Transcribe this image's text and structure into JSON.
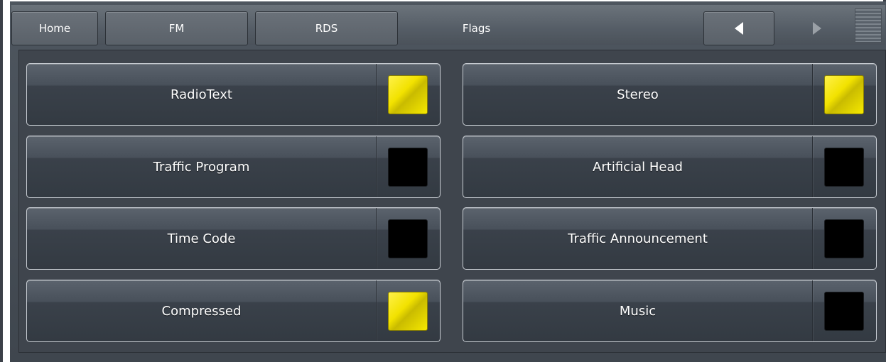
{
  "nav": {
    "home_label": "Home",
    "fm_label": "FM",
    "rds_label": "RDS",
    "page_label": "Flags",
    "prev_icon": "chevron-left-icon",
    "next_icon": "chevron-right-icon",
    "menu_icon": "menu-lines-icon"
  },
  "colors": {
    "lamp_on": "#f2e200",
    "lamp_off": "#000000"
  },
  "flags": [
    {
      "label": "RadioText",
      "state": "on"
    },
    {
      "label": "Stereo",
      "state": "on"
    },
    {
      "label": "Traffic Program",
      "state": "off"
    },
    {
      "label": "Artificial Head",
      "state": "off"
    },
    {
      "label": "Time Code",
      "state": "off"
    },
    {
      "label": "Traffic Announcement",
      "state": "off"
    },
    {
      "label": "Compressed",
      "state": "on"
    },
    {
      "label": "Music",
      "state": "off"
    }
  ]
}
